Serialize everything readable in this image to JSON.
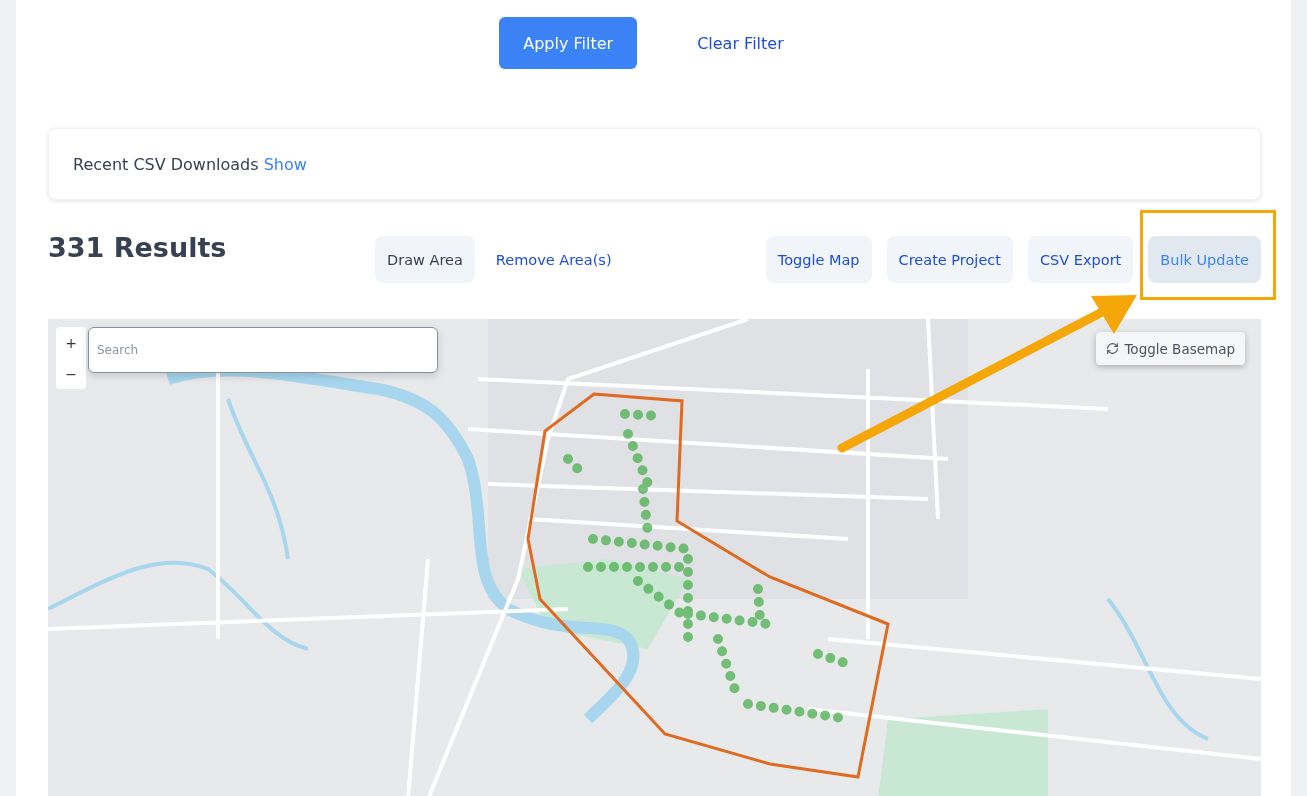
{
  "filter_actions": [
    {
      "label": "Apply Filter",
      "kind": "primary"
    },
    {
      "label": "Clear Filter",
      "kind": "link"
    }
  ],
  "recent_downloads": {
    "label": "Recent CSV Downloads",
    "link": "Show"
  },
  "results": {
    "count_label": "331 Results"
  },
  "area_actions": [
    {
      "label": "Draw Area",
      "kind": "button"
    },
    {
      "label": "Remove Area(s)",
      "kind": "link"
    }
  ],
  "actions": [
    {
      "label": "Toggle Map",
      "highlighted": false
    },
    {
      "label": "Create Project",
      "highlighted": false
    },
    {
      "label": "CSV Export",
      "highlighted": false
    },
    {
      "label": "Bulk Update",
      "highlighted": true
    }
  ],
  "map": {
    "zoom_in": "+",
    "zoom_out": "−",
    "search": {
      "placeholder": "Search"
    },
    "basemap_button": "Toggle Basemap"
  }
}
